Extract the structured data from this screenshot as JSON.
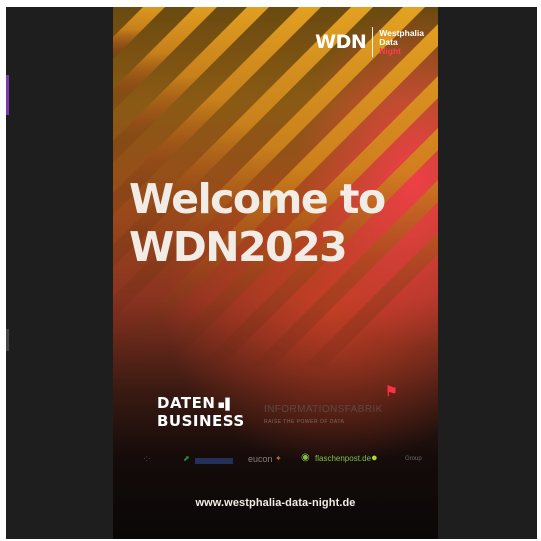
{
  "logo": {
    "wdn": "WDN",
    "line1": "Westphalia",
    "line2": "Data",
    "line3": "Night"
  },
  "headline": {
    "line1": "Welcome to",
    "line2": "WDN2023"
  },
  "partners": {
    "daten_business_line1": "DATEN",
    "daten_business_line2": "BUSINESS",
    "informationsfabrik": "INFORMATIONSFABRIK",
    "informationsfabrik_tagline": "RAISE THE POWER OF DATA"
  },
  "sponsors": {
    "eucon": "eucon",
    "flaschenpost": "flaschenpost.de",
    "group": "Group"
  },
  "url": "www.westphalia-data-night.de",
  "colors": {
    "accent_red": "#ff3b54",
    "stripe_gold": "#d69a1e",
    "backdrop": "#1e1e1e"
  }
}
